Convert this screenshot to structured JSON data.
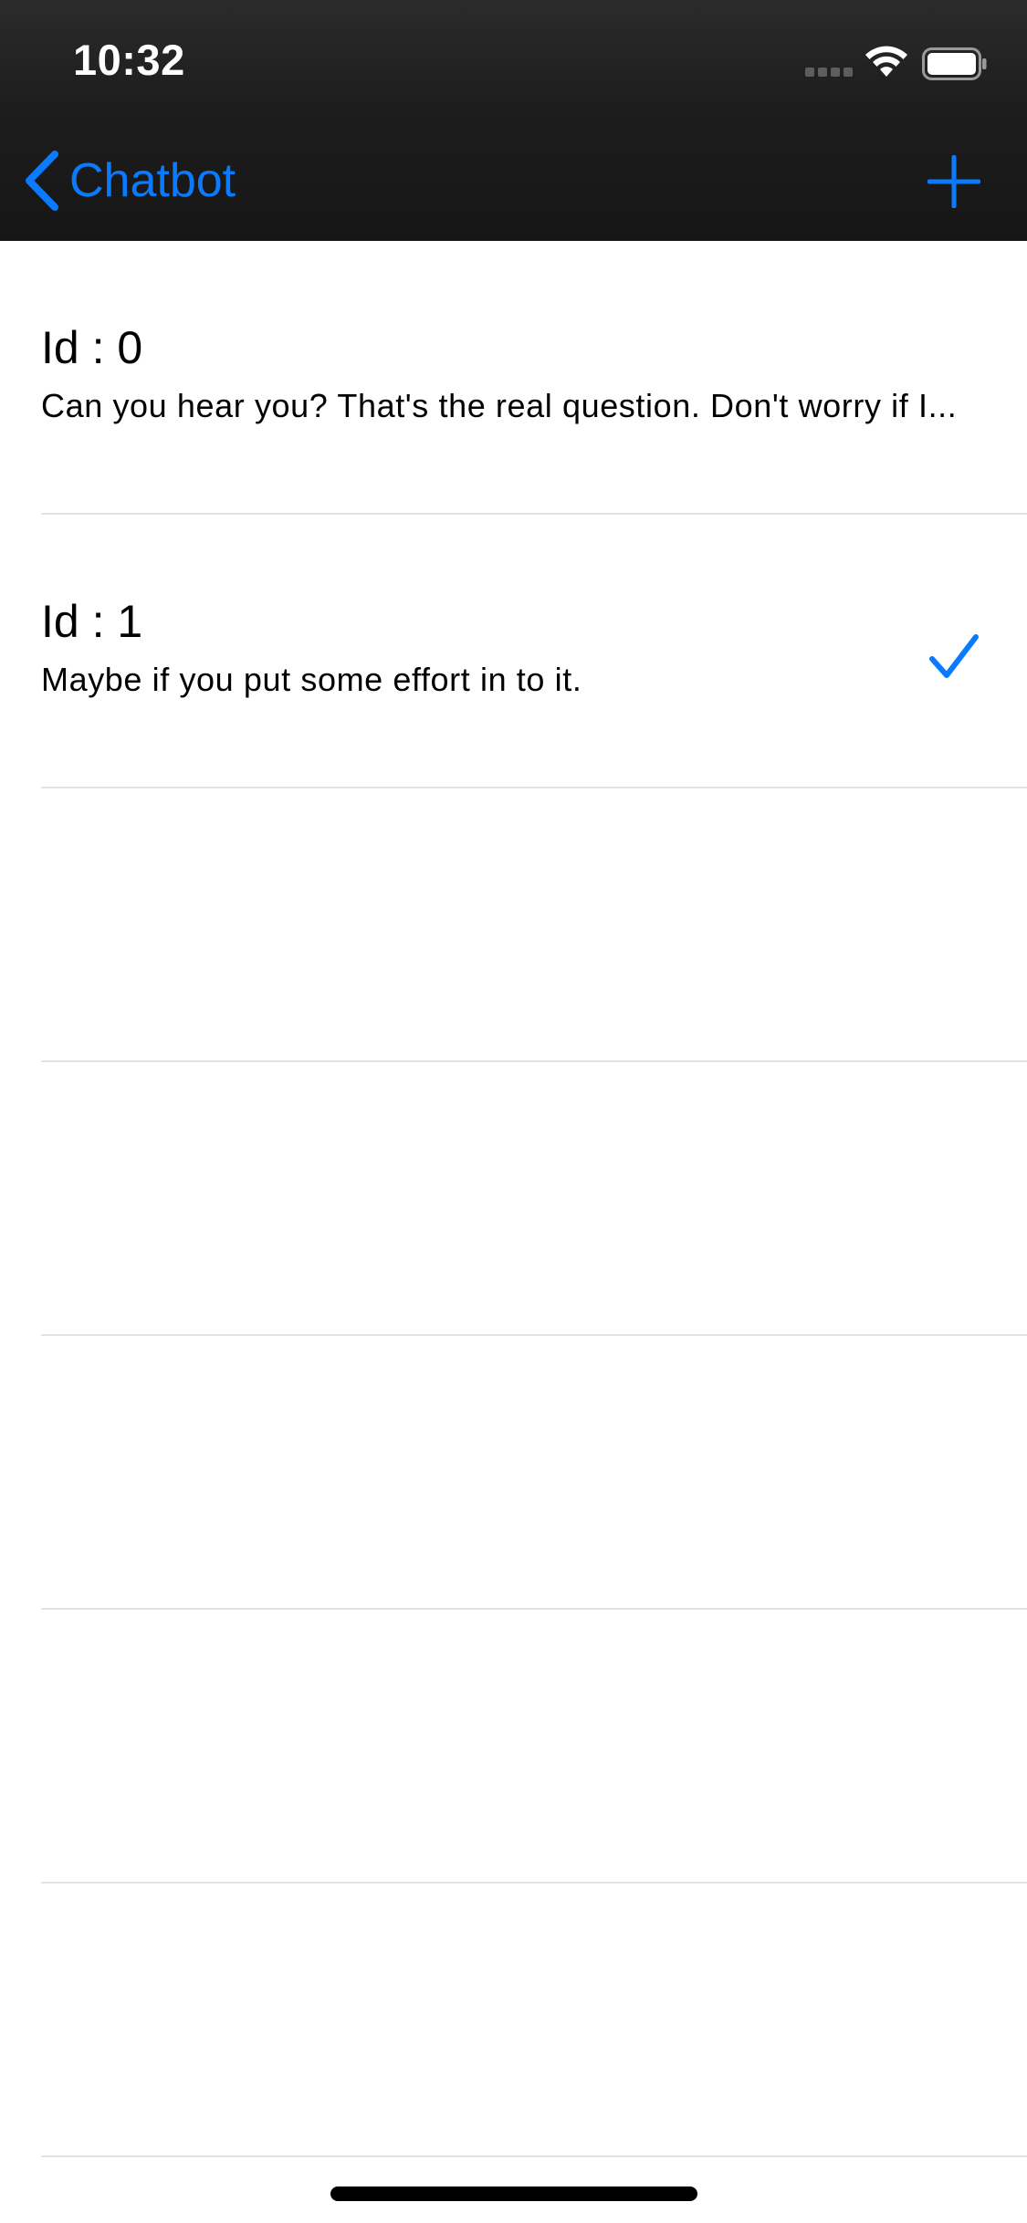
{
  "status_bar": {
    "time": "10:32"
  },
  "nav_bar": {
    "back_label": "Chatbot",
    "back_icon": "chevron-left-icon",
    "add_icon": "plus-icon",
    "accent_color": "#0a7aff"
  },
  "list": {
    "items": [
      {
        "title": "Id : 0",
        "subtitle": "Can you hear you? That's the real question. Don't worry if I...",
        "checked": false
      },
      {
        "title": "Id : 1",
        "subtitle": "Maybe if you put some effort in to it.",
        "checked": true
      }
    ],
    "empty_rows": 5
  }
}
